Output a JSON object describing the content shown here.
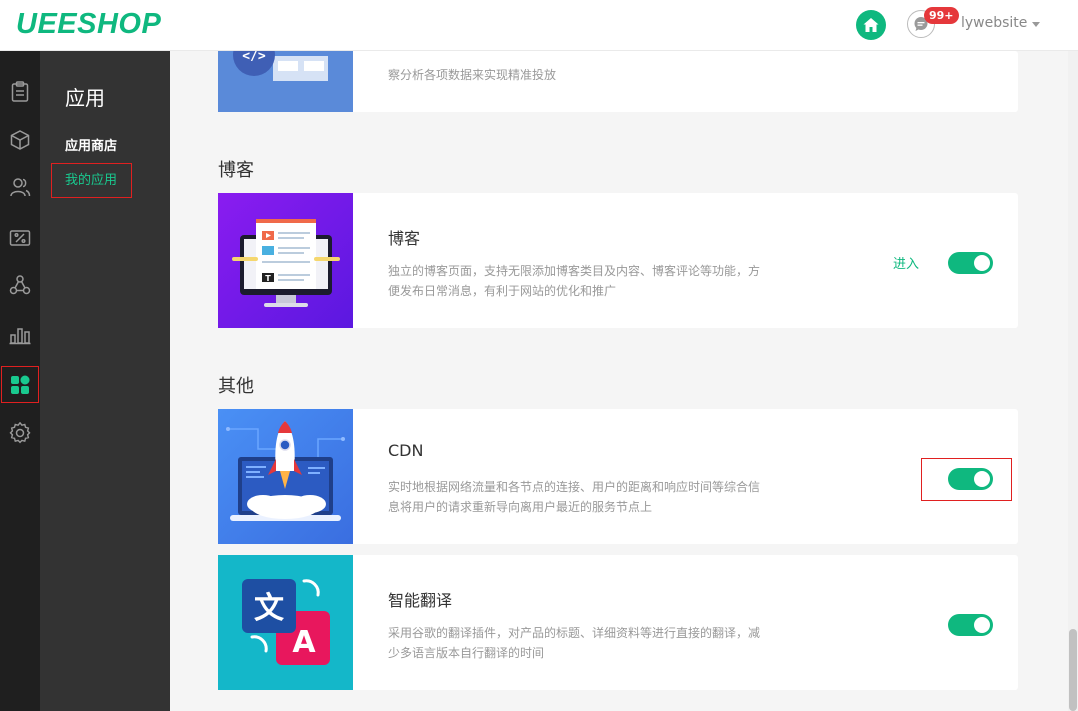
{
  "header": {
    "logo": "UEESHOP",
    "badge": "99+",
    "username": "lywebsite"
  },
  "icons": [
    "home-icon",
    "message-icon",
    "clipboard-icon",
    "box-icon",
    "users-icon",
    "discount-icon",
    "share-icon",
    "stats-icon",
    "apps-icon",
    "settings-icon"
  ],
  "subnav": {
    "title": "应用",
    "items": [
      {
        "label": "应用商店"
      },
      {
        "label": "我的应用",
        "active": true
      }
    ]
  },
  "partial_card": {
    "desc": "察分析各项数据来实现精准投放"
  },
  "sections": [
    {
      "title": "博客",
      "apps": [
        {
          "name": "博客",
          "desc": "独立的博客页面，支持无限添加博客类目及内容、博客评论等功能，方便发布日常消息，有利于网站的优化和推广",
          "action": "进入",
          "enabled": true
        }
      ]
    },
    {
      "title": "其他",
      "apps": [
        {
          "name": "CDN",
          "desc": "实时地根据网络流量和各节点的连接、用户的距离和响应时间等综合信息将用户的请求重新导向离用户最近的服务节点上",
          "enabled": true
        },
        {
          "name": "智能翻译",
          "desc": "采用谷歌的翻译插件，对产品的标题、详细资料等进行直接的翻译，减少多语言版本自行翻译的时间",
          "enabled": true,
          "thumb_glyph_1": "文",
          "thumb_glyph_2": "A"
        }
      ]
    }
  ],
  "colors": {
    "accent": "#0fb87f",
    "sidebar_dark": "#1f1f1f",
    "subnav_bg": "#333333",
    "highlight_red": "#e02020"
  }
}
